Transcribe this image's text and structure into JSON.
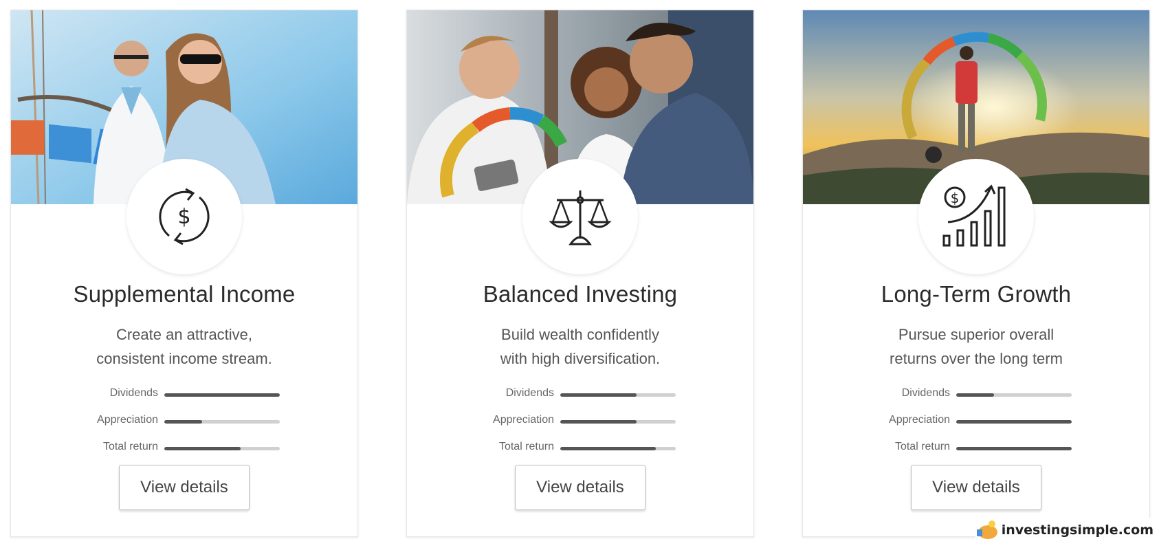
{
  "cards": [
    {
      "title": "Supplemental Income",
      "description": [
        "Create an attractive,",
        "consistent income stream."
      ],
      "icon": "dollar-cycle-icon",
      "metrics": [
        {
          "label": "Dividends",
          "value": 1.0
        },
        {
          "label": "Appreciation",
          "value": 0.33
        },
        {
          "label": "Total return",
          "value": 0.66
        }
      ],
      "button_label": "View details"
    },
    {
      "title": "Balanced Investing",
      "description": [
        "Build wealth confidently",
        "with high diversification."
      ],
      "icon": "balance-scale-icon",
      "metrics": [
        {
          "label": "Dividends",
          "value": 0.66
        },
        {
          "label": "Appreciation",
          "value": 0.66
        },
        {
          "label": "Total return",
          "value": 0.83
        }
      ],
      "button_label": "View details"
    },
    {
      "title": "Long-Term Growth",
      "description": [
        "Pursue superior overall",
        "returns over the long term"
      ],
      "icon": "growth-chart-icon",
      "metrics": [
        {
          "label": "Dividends",
          "value": 0.33
        },
        {
          "label": "Appreciation",
          "value": 1.0
        },
        {
          "label": "Total return",
          "value": 1.0
        }
      ],
      "button_label": "View details"
    }
  ],
  "watermark": {
    "text": "investingsimple.com"
  },
  "colors": {
    "bar_fill": "#555555",
    "bar_track": "#d0d0d0",
    "title": "#2b2b2b"
  }
}
